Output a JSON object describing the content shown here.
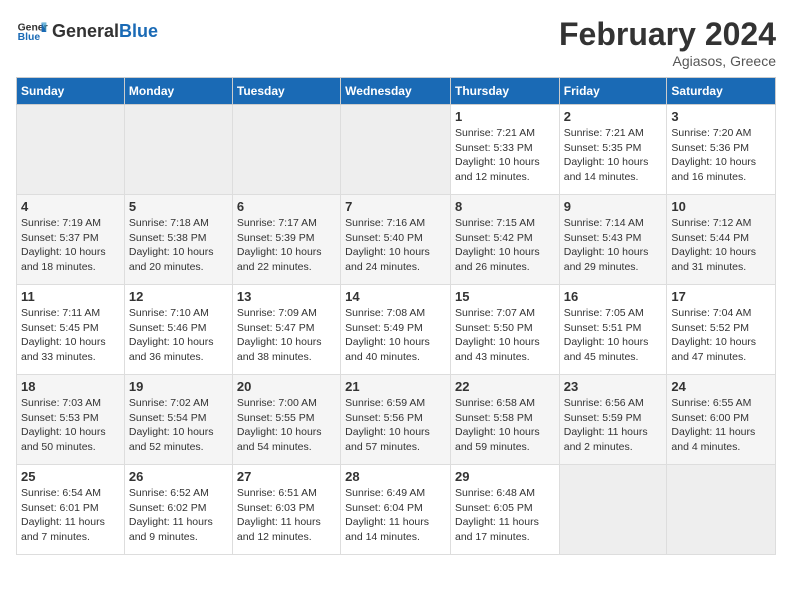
{
  "app": {
    "name_part1": "General",
    "name_part2": "Blue"
  },
  "calendar": {
    "month": "February 2024",
    "location": "Agiasos, Greece"
  },
  "headers": [
    "Sunday",
    "Monday",
    "Tuesday",
    "Wednesday",
    "Thursday",
    "Friday",
    "Saturday"
  ],
  "weeks": [
    [
      {
        "day": "",
        "info": ""
      },
      {
        "day": "",
        "info": ""
      },
      {
        "day": "",
        "info": ""
      },
      {
        "day": "",
        "info": ""
      },
      {
        "day": "1",
        "info": "Sunrise: 7:21 AM\nSunset: 5:33 PM\nDaylight: 10 hours\nand 12 minutes."
      },
      {
        "day": "2",
        "info": "Sunrise: 7:21 AM\nSunset: 5:35 PM\nDaylight: 10 hours\nand 14 minutes."
      },
      {
        "day": "3",
        "info": "Sunrise: 7:20 AM\nSunset: 5:36 PM\nDaylight: 10 hours\nand 16 minutes."
      }
    ],
    [
      {
        "day": "4",
        "info": "Sunrise: 7:19 AM\nSunset: 5:37 PM\nDaylight: 10 hours\nand 18 minutes."
      },
      {
        "day": "5",
        "info": "Sunrise: 7:18 AM\nSunset: 5:38 PM\nDaylight: 10 hours\nand 20 minutes."
      },
      {
        "day": "6",
        "info": "Sunrise: 7:17 AM\nSunset: 5:39 PM\nDaylight: 10 hours\nand 22 minutes."
      },
      {
        "day": "7",
        "info": "Sunrise: 7:16 AM\nSunset: 5:40 PM\nDaylight: 10 hours\nand 24 minutes."
      },
      {
        "day": "8",
        "info": "Sunrise: 7:15 AM\nSunset: 5:42 PM\nDaylight: 10 hours\nand 26 minutes."
      },
      {
        "day": "9",
        "info": "Sunrise: 7:14 AM\nSunset: 5:43 PM\nDaylight: 10 hours\nand 29 minutes."
      },
      {
        "day": "10",
        "info": "Sunrise: 7:12 AM\nSunset: 5:44 PM\nDaylight: 10 hours\nand 31 minutes."
      }
    ],
    [
      {
        "day": "11",
        "info": "Sunrise: 7:11 AM\nSunset: 5:45 PM\nDaylight: 10 hours\nand 33 minutes."
      },
      {
        "day": "12",
        "info": "Sunrise: 7:10 AM\nSunset: 5:46 PM\nDaylight: 10 hours\nand 36 minutes."
      },
      {
        "day": "13",
        "info": "Sunrise: 7:09 AM\nSunset: 5:47 PM\nDaylight: 10 hours\nand 38 minutes."
      },
      {
        "day": "14",
        "info": "Sunrise: 7:08 AM\nSunset: 5:49 PM\nDaylight: 10 hours\nand 40 minutes."
      },
      {
        "day": "15",
        "info": "Sunrise: 7:07 AM\nSunset: 5:50 PM\nDaylight: 10 hours\nand 43 minutes."
      },
      {
        "day": "16",
        "info": "Sunrise: 7:05 AM\nSunset: 5:51 PM\nDaylight: 10 hours\nand 45 minutes."
      },
      {
        "day": "17",
        "info": "Sunrise: 7:04 AM\nSunset: 5:52 PM\nDaylight: 10 hours\nand 47 minutes."
      }
    ],
    [
      {
        "day": "18",
        "info": "Sunrise: 7:03 AM\nSunset: 5:53 PM\nDaylight: 10 hours\nand 50 minutes."
      },
      {
        "day": "19",
        "info": "Sunrise: 7:02 AM\nSunset: 5:54 PM\nDaylight: 10 hours\nand 52 minutes."
      },
      {
        "day": "20",
        "info": "Sunrise: 7:00 AM\nSunset: 5:55 PM\nDaylight: 10 hours\nand 54 minutes."
      },
      {
        "day": "21",
        "info": "Sunrise: 6:59 AM\nSunset: 5:56 PM\nDaylight: 10 hours\nand 57 minutes."
      },
      {
        "day": "22",
        "info": "Sunrise: 6:58 AM\nSunset: 5:58 PM\nDaylight: 10 hours\nand 59 minutes."
      },
      {
        "day": "23",
        "info": "Sunrise: 6:56 AM\nSunset: 5:59 PM\nDaylight: 11 hours\nand 2 minutes."
      },
      {
        "day": "24",
        "info": "Sunrise: 6:55 AM\nSunset: 6:00 PM\nDaylight: 11 hours\nand 4 minutes."
      }
    ],
    [
      {
        "day": "25",
        "info": "Sunrise: 6:54 AM\nSunset: 6:01 PM\nDaylight: 11 hours\nand 7 minutes."
      },
      {
        "day": "26",
        "info": "Sunrise: 6:52 AM\nSunset: 6:02 PM\nDaylight: 11 hours\nand 9 minutes."
      },
      {
        "day": "27",
        "info": "Sunrise: 6:51 AM\nSunset: 6:03 PM\nDaylight: 11 hours\nand 12 minutes."
      },
      {
        "day": "28",
        "info": "Sunrise: 6:49 AM\nSunset: 6:04 PM\nDaylight: 11 hours\nand 14 minutes."
      },
      {
        "day": "29",
        "info": "Sunrise: 6:48 AM\nSunset: 6:05 PM\nDaylight: 11 hours\nand 17 minutes."
      },
      {
        "day": "",
        "info": ""
      },
      {
        "day": "",
        "info": ""
      }
    ]
  ]
}
